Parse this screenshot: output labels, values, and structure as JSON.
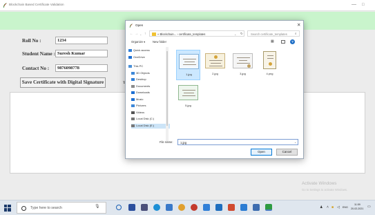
{
  "window": {
    "title": "Blockchain Based Certificate Validation",
    "minimize_glyph": "—",
    "maximize_glyph": "□"
  },
  "form": {
    "roll_label": "Roll No :",
    "roll_value": "1234",
    "student_label": "Student Name :",
    "student_value": "Suresh Kumar",
    "contact_label": "Contact No :",
    "contact_value": "9876098778",
    "save_button": "Save Certificate with Digital Signature",
    "partial_button_glyph": "T"
  },
  "watermark": {
    "line1": "Activate Windows",
    "line2": "Go to Settings to activate Windows."
  },
  "dialog": {
    "title": "Open",
    "close_glyph": "✕",
    "breadcrumb": "« Blockchain... › certificate_templates",
    "search_placeholder": "Search certificate_templates",
    "organize_label": "Organize ▾",
    "new_folder_label": "New folder",
    "help_glyph": "?",
    "nav_items": [
      {
        "label": "Quick access",
        "icon": "star-icon",
        "color": "#2f7fd8"
      },
      {
        "label": "OneDrive",
        "icon": "cloud-icon",
        "color": "#1d6fd3"
      },
      {
        "label": "This PC",
        "icon": "computer-icon",
        "color": "#4a90d9"
      },
      {
        "label": "3D Objects",
        "icon": "cube-icon",
        "color": "#3d88d8"
      },
      {
        "label": "Desktop",
        "icon": "desktop-icon",
        "color": "#2f7fd8"
      },
      {
        "label": "Documents",
        "icon": "documents-icon",
        "color": "#8a8a8a"
      },
      {
        "label": "Downloads",
        "icon": "download-icon",
        "color": "#1d6fd3"
      },
      {
        "label": "Music",
        "icon": "music-icon",
        "color": "#1d6fd3"
      },
      {
        "label": "Pictures",
        "icon": "pictures-icon",
        "color": "#3d88d8"
      },
      {
        "label": "Videos",
        "icon": "videos-icon",
        "color": "#555555"
      },
      {
        "label": "Local Disk (C:)",
        "icon": "disk-icon",
        "color": "#777777"
      },
      {
        "label": "Local Disk (E:)",
        "icon": "disk-icon",
        "color": "#777777"
      }
    ],
    "files": [
      {
        "name": "1.jpg",
        "selected": true
      },
      {
        "name": "2.jpg",
        "selected": false
      },
      {
        "name": "3.jpg",
        "selected": false
      },
      {
        "name": "4.png",
        "selected": false
      },
      {
        "name": "5.jpg",
        "selected": false
      }
    ],
    "filename_label": "File name:",
    "filename_value": "1.jpg",
    "open_button": "Open",
    "cancel_button": "Cancel"
  },
  "taskbar": {
    "search_placeholder": "Type here to search",
    "time": "11:59",
    "date": "20-02-2021",
    "language": "ENG"
  },
  "colors": {
    "green_band": "#c9f4cc",
    "accent": "#0078d7",
    "selection": "#cce8ff"
  }
}
